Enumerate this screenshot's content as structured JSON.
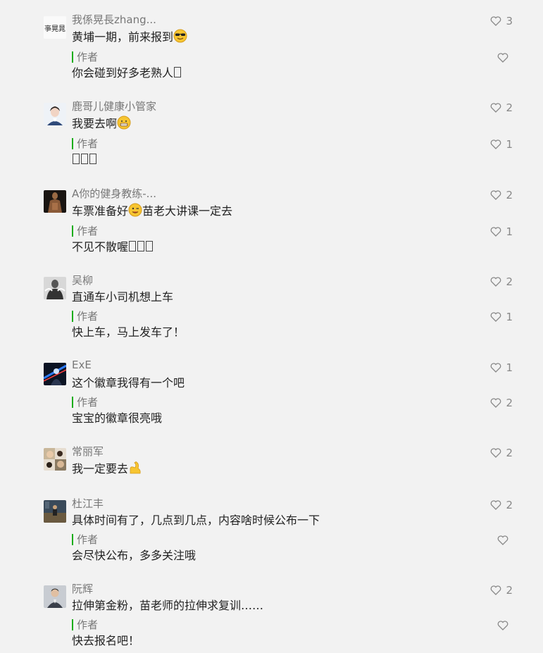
{
  "colors": {
    "accent": "#1aad19",
    "background": "#f2f2f2"
  },
  "comments": [
    {
      "nickname": "我係晃長zhang...",
      "text": "黄埔一期，前来报到",
      "emoji": "sunglasses-emoji",
      "likes": "3",
      "reply": {
        "label": "作者",
        "text": "你会碰到好多老熟人",
        "boxes": 1,
        "likes": ""
      }
    },
    {
      "nickname": "鹿哥儿健康小管家",
      "text": "我要去啊",
      "emoji": "grimace-emoji",
      "likes": "2",
      "reply": {
        "label": "作者",
        "text": "",
        "boxes": 3,
        "likes": "1"
      }
    },
    {
      "nickname": "A你的健身教练-...",
      "text": "车票准备好",
      "emoji": "wink-emoji",
      "text_after": "苗老大讲课一定去",
      "likes": "2",
      "reply": {
        "label": "作者",
        "text": "不见不散喔",
        "boxes": 3,
        "likes": "1"
      }
    },
    {
      "nickname": "吴柳",
      "text": "直通车小司机想上车",
      "likes": "2",
      "reply": {
        "label": "作者",
        "text": "快上车，马上发车了！",
        "likes": "1"
      }
    },
    {
      "nickname": "ExE",
      "text": "这个徽章我得有一个吧",
      "likes": "1",
      "reply": {
        "label": "作者",
        "text": "宝宝的徽章很亮哦",
        "likes": "2"
      }
    },
    {
      "nickname": "常丽军",
      "text": "我一定要去",
      "emoji": "flexed-bicep-emoji",
      "likes": "2"
    },
    {
      "nickname": "杜江丰",
      "text": "具体时间有了，几点到几点，内容啥时候公布一下",
      "likes": "2",
      "reply": {
        "label": "作者",
        "text": "会尽快公布，多多关注哦",
        "likes": ""
      }
    },
    {
      "nickname": "阮辉",
      "text": "拉伸第金粉，苗老师的拉伸求复训……",
      "likes": "2",
      "reply": {
        "label": "作者",
        "text": "快去报名吧！",
        "likes": ""
      }
    }
  ]
}
